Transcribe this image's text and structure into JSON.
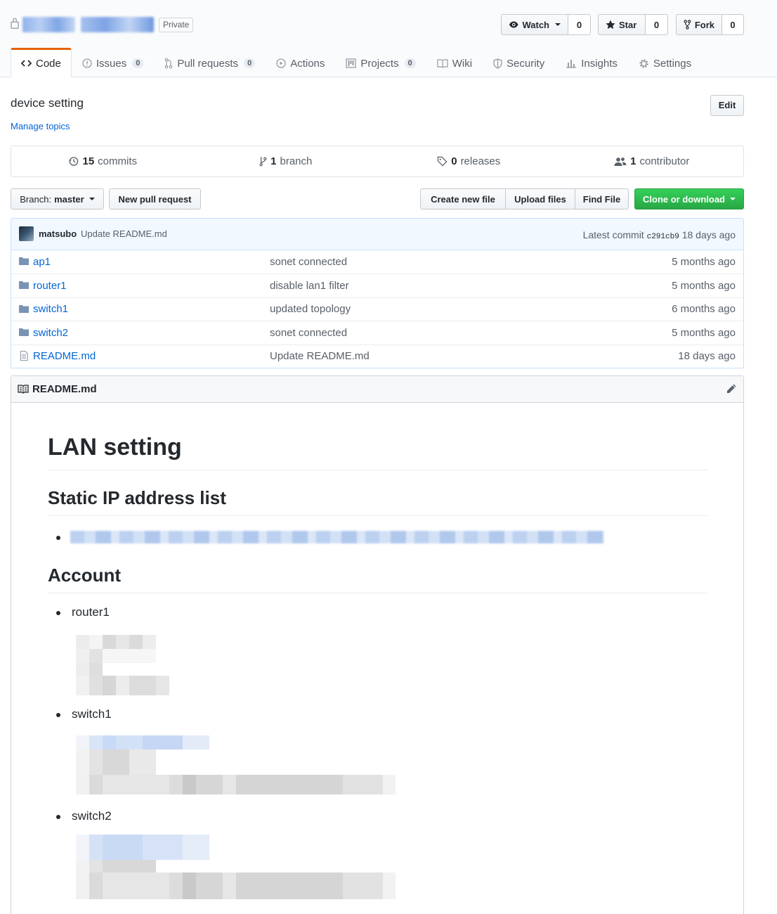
{
  "repo": {
    "private_label": "Private"
  },
  "actions": {
    "watch_label": "Watch",
    "watch_count": "0",
    "star_label": "Star",
    "star_count": "0",
    "fork_label": "Fork",
    "fork_count": "0"
  },
  "nav": {
    "code": "Code",
    "issues": "Issues",
    "issues_count": "0",
    "pulls": "Pull requests",
    "pulls_count": "0",
    "actions": "Actions",
    "projects": "Projects",
    "projects_count": "0",
    "wiki": "Wiki",
    "security": "Security",
    "insights": "Insights",
    "settings": "Settings"
  },
  "description": {
    "text": "device setting",
    "manage_topics": "Manage topics",
    "edit_label": "Edit"
  },
  "summary": {
    "commits_num": "15",
    "commits_label": "commits",
    "branch_num": "1",
    "branch_label": "branch",
    "releases_num": "0",
    "releases_label": "releases",
    "contributor_num": "1",
    "contributor_label": "contributor"
  },
  "file_nav": {
    "branch_prefix": "Branch:",
    "branch_name": "master",
    "new_pr": "New pull request",
    "create_file": "Create new file",
    "upload_files": "Upload files",
    "find_file": "Find File",
    "clone": "Clone or download"
  },
  "commit": {
    "author": "matsubo",
    "message": "Update README.md",
    "latest_label": "Latest commit",
    "sha": "c291cb9",
    "age": "18 days ago"
  },
  "files": [
    {
      "type": "dir",
      "name": "ap1",
      "message": "sonet connected",
      "age": "5 months ago"
    },
    {
      "type": "dir",
      "name": "router1",
      "message": "disable lan1 filter",
      "age": "5 months ago"
    },
    {
      "type": "dir",
      "name": "switch1",
      "message": "updated topology",
      "age": "6 months ago"
    },
    {
      "type": "dir",
      "name": "switch2",
      "message": "sonet connected",
      "age": "5 months ago"
    },
    {
      "type": "file",
      "name": "README.md",
      "message": "Update README.md",
      "age": "18 days ago"
    }
  ],
  "readme": {
    "filename": "README.md",
    "h1": "LAN setting",
    "h2_static": "Static IP address list",
    "h2_account": "Account",
    "items": [
      "router1",
      "switch1",
      "switch2"
    ]
  },
  "colors": {
    "link": "#0366d6",
    "primary_button": "#28a745",
    "selected_tab_accent": "#e36209"
  }
}
